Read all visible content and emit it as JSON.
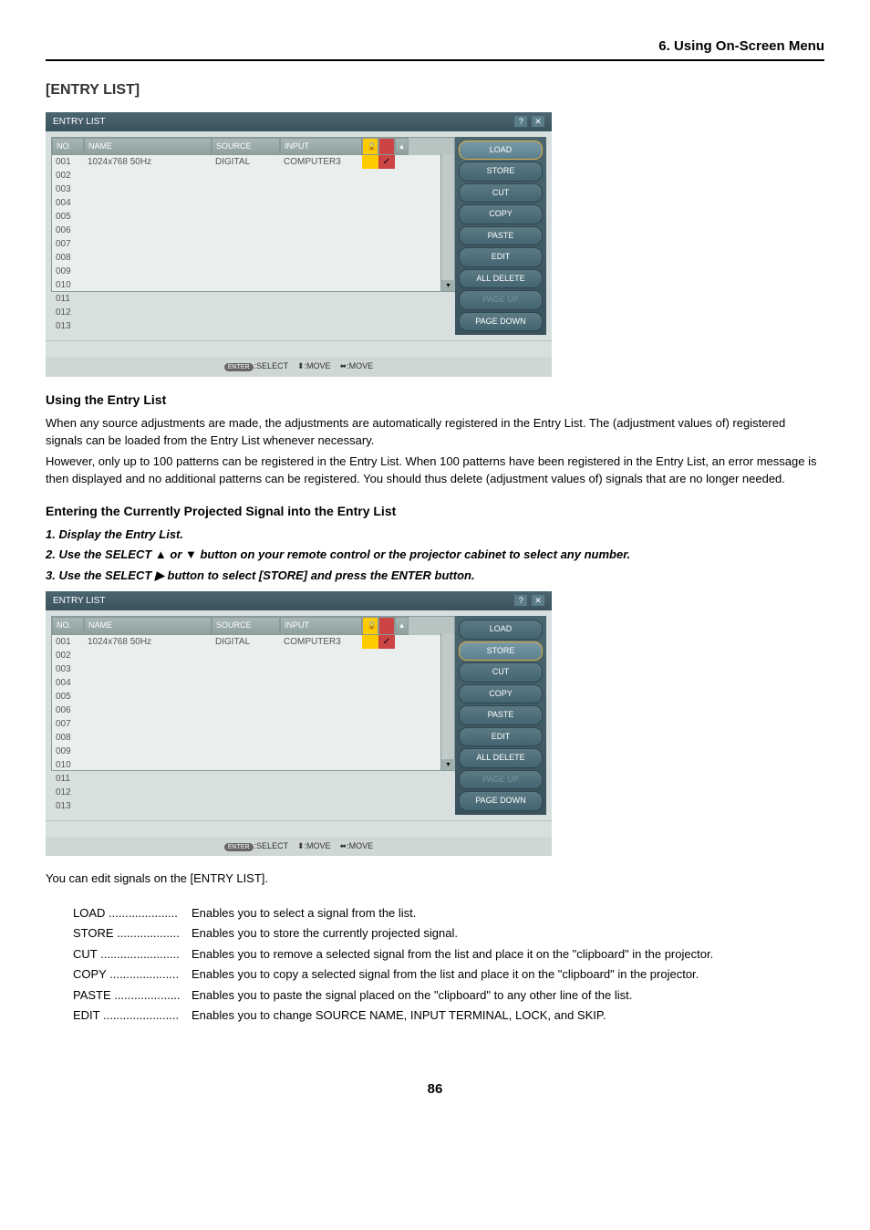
{
  "chapter_header": "6. Using On-Screen Menu",
  "section_title": "[ENTRY LIST]",
  "entry_list_window": {
    "title": "ENTRY LIST",
    "columns": {
      "no": "NO.",
      "name": "NAME",
      "source": "SOURCE",
      "input": "INPUT"
    },
    "rows": [
      {
        "no": "001",
        "name": "1024x768 50Hz",
        "source": "DIGITAL",
        "input": "COMPUTER3",
        "check": "✓"
      },
      {
        "no": "002"
      },
      {
        "no": "003"
      },
      {
        "no": "004"
      },
      {
        "no": "005"
      },
      {
        "no": "006"
      },
      {
        "no": "007"
      },
      {
        "no": "008"
      },
      {
        "no": "009"
      },
      {
        "no": "010"
      },
      {
        "no": "011"
      },
      {
        "no": "012"
      },
      {
        "no": "013"
      }
    ],
    "buttons": {
      "load": "LOAD",
      "store": "STORE",
      "cut": "CUT",
      "copy": "COPY",
      "paste": "PASTE",
      "edit": "EDIT",
      "all_delete": "ALL DELETE",
      "page_up": "PAGE UP",
      "page_down": "PAGE DOWN"
    },
    "statusbar": {
      "enter": "ENTER",
      "select": ":SELECT",
      "move1": ":MOVE",
      "move2": ":MOVE"
    }
  },
  "subsection1_title": "Using the Entry List",
  "body1": "When any source adjustments are made, the adjustments are automatically registered in the Entry List. The (adjustment values of) registered signals can be loaded from the Entry List whenever necessary.",
  "body2": "However, only up to 100 patterns can be registered in the Entry List. When 100 patterns have been registered in the Entry List, an error message is then displayed and no additional patterns can be registered. You should thus delete (adjustment values of) signals that are no longer needed.",
  "subsection2_title": "Entering the Currently Projected Signal into the Entry List",
  "steps": {
    "s1": "1.  Display the Entry List.",
    "s2": "2.  Use the SELECT ▲ or ▼ button on your remote control or the projector cabinet to select any number.",
    "s3": "3.  Use the SELECT ▶ button to select [STORE] and press the ENTER button."
  },
  "edit_intro": "You can edit signals on the [ENTRY LIST].",
  "definitions": [
    {
      "term": "LOAD",
      "dots": ".....................",
      "desc": "Enables you to select a signal from the list."
    },
    {
      "term": "STORE",
      "dots": "...................",
      "desc": "Enables you to store the currently projected signal."
    },
    {
      "term": "CUT",
      "dots": "........................",
      "desc": "Enables you to remove a selected signal from the list and place it on the \"clipboard\" in the projector."
    },
    {
      "term": "COPY",
      "dots": ".....................",
      "desc": "Enables you to copy a selected signal from the list and place it on the \"clipboard\" in the projector."
    },
    {
      "term": "PASTE",
      "dots": "....................",
      "desc": "Enables you to paste the signal placed on the \"clipboard\" to any other line of the list."
    },
    {
      "term": "EDIT",
      "dots": ".......................",
      "desc": "Enables you to change SOURCE NAME, INPUT TERMINAL, LOCK, and SKIP."
    }
  ],
  "page_number": "86"
}
